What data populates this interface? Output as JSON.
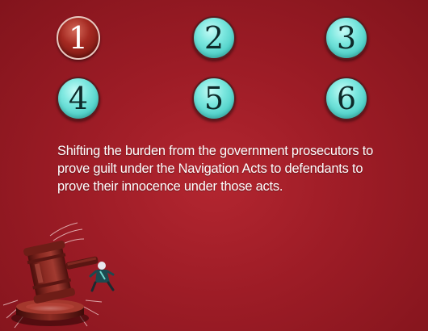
{
  "answer_buttons": [
    {
      "label": "1",
      "state": "selected",
      "color": "#a52a22"
    },
    {
      "label": "2",
      "state": "default",
      "color": "#5cd6cc"
    },
    {
      "label": "3",
      "state": "default",
      "color": "#5cd6cc"
    },
    {
      "label": "4",
      "state": "default",
      "color": "#5cd6cc"
    },
    {
      "label": "5",
      "state": "default",
      "color": "#5cd6cc"
    },
    {
      "label": "6",
      "state": "default",
      "color": "#5cd6cc"
    }
  ],
  "question": {
    "text": "Shifting the burden from the government prosecutors to prove guilt under the Navigation Acts to defendants to prove their innocence under those acts."
  },
  "illustration": {
    "icon": "gavel-striking-figure-icon"
  },
  "colors": {
    "background": "#9d1c26",
    "text": "#ffffff"
  }
}
